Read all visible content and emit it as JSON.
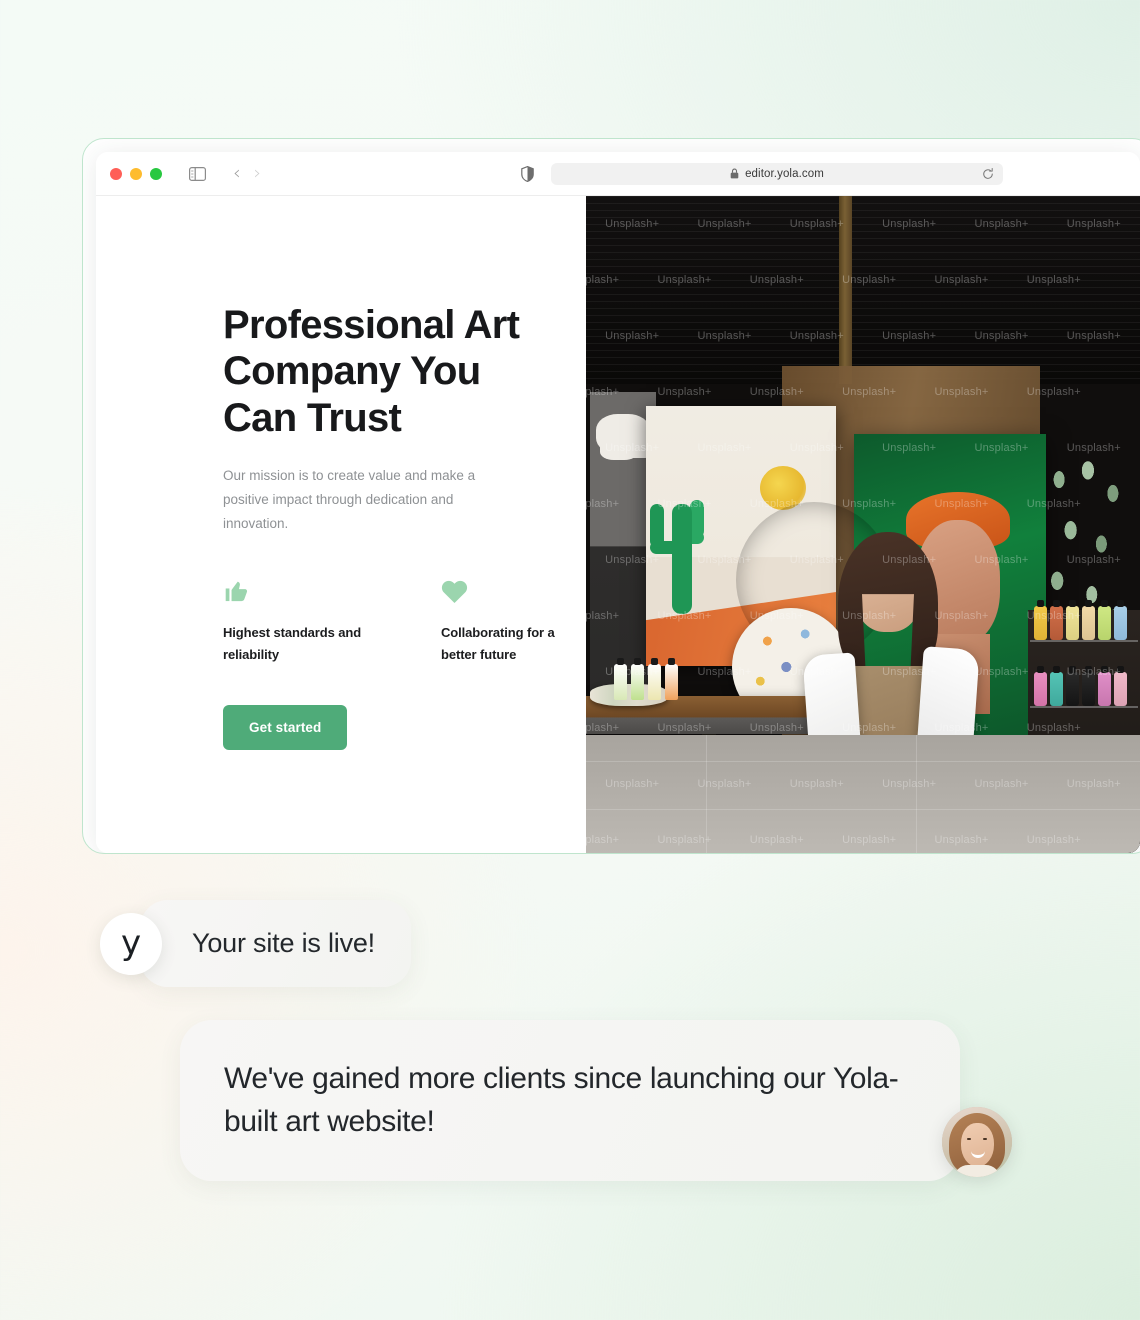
{
  "browser": {
    "traffic_lights": [
      "close",
      "minimize",
      "zoom"
    ],
    "sidebar_icon": "sidebar-toggle-icon",
    "back_icon": "chevron-left-icon",
    "forward_icon": "chevron-right-icon",
    "shield_icon": "privacy-shield-icon",
    "lock_icon": "lock-icon",
    "url": "editor.yola.com",
    "reload_icon": "reload-icon"
  },
  "site": {
    "headline": "Professional Art Company You Can Trust",
    "subtext": "Our mission is to create value and make a positive impact through dedication and innovation.",
    "features": [
      {
        "icon": "thumbs-up-icon",
        "label": "Highest standards and reliability"
      },
      {
        "icon": "heart-icon",
        "label": "Collaborating for a better future"
      }
    ],
    "cta_label": "Get started",
    "hero_image_alt": "Artist sitting in art studio surrounded by paintings and paint supplies",
    "hero_watermark": "Unsplash+"
  },
  "chat": {
    "messages": [
      {
        "avatar": "yola-logo-avatar",
        "avatar_letter": "y",
        "text": "Your site is live!"
      },
      {
        "avatar": "user-photo-avatar",
        "text": "We've gained more clients since launching our Yola-built art website!"
      }
    ]
  },
  "colors": {
    "accent_green": "#4fab79",
    "feature_icon_green": "#9bd5ae",
    "window_border": "#bfe5cd",
    "headline": "#18191b",
    "subtext": "#8e9194"
  }
}
